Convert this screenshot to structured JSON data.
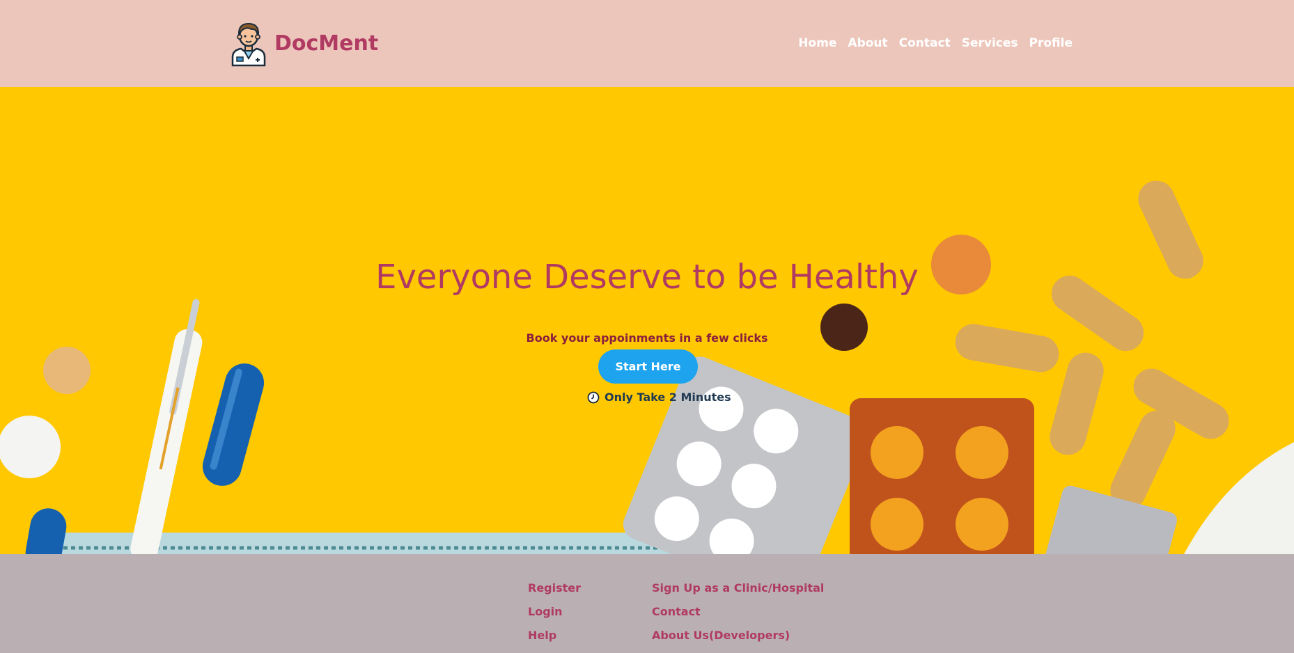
{
  "header": {
    "brand": "DocMent",
    "nav": [
      "Home",
      "About",
      "Contact",
      "Services",
      "Profile"
    ]
  },
  "hero": {
    "title": "Everyone Deserve to be Healthy",
    "subtitle": "Book your appoinments in a few clicks",
    "cta_label": "Start Here",
    "duration_text": "Only Take 2 Minutes"
  },
  "footer": {
    "col1": [
      "Register",
      "Login",
      "Help"
    ],
    "col2": [
      "Sign Up as a Clinic/Hospital",
      "Contact",
      "About Us(Developers)"
    ]
  },
  "colors": {
    "header_bg": "#ecc6ba",
    "hero_bg": "#ffc800",
    "brand": "#b03a62",
    "cta": "#1ea3ee",
    "footer_bg": "#bab0b3"
  }
}
